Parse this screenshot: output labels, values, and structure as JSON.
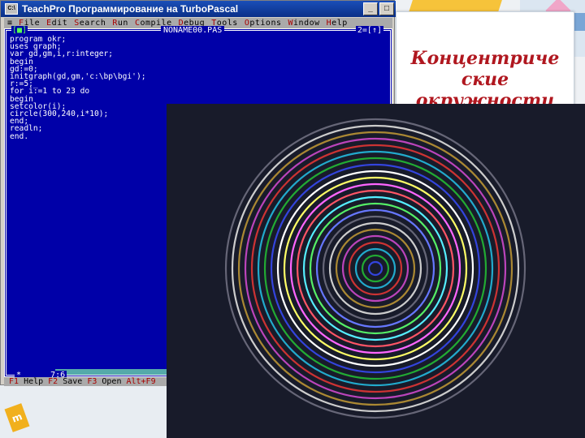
{
  "window": {
    "title": "TeachPro Программирование на TurboPascal",
    "app_icon_text": "C:\\"
  },
  "menu": [
    {
      "key": "F",
      "rest": "ile"
    },
    {
      "key": "E",
      "rest": "dit"
    },
    {
      "key": "S",
      "rest": "earch"
    },
    {
      "key": "R",
      "rest": "un"
    },
    {
      "key": "C",
      "rest": "ompile"
    },
    {
      "key": "D",
      "rest": "ebug"
    },
    {
      "key": "T",
      "rest": "ools"
    },
    {
      "key": "O",
      "rest": "ptions"
    },
    {
      "key": "W",
      "rest": "indow"
    },
    {
      "key": "H",
      "rest": "elp"
    }
  ],
  "editor": {
    "close_box": "[■]",
    "filename": "NONAME00.PAS",
    "window_number": "2=[↑]",
    "cursor_position": "7:6",
    "modified_marker": "*",
    "code": [
      "program okr;",
      "uses graph;",
      "var gd,gm,i,r:integer;",
      "begin",
      "gd:=0;",
      "initgraph(gd,gm,'c:\\bp\\bgi');",
      "r:=5;_",
      "for i:=1 to 23 do",
      "begin",
      "setcolor(i);",
      "circle(300,240,i*10);",
      "end;",
      "readln;",
      "end."
    ]
  },
  "statusbar": [
    {
      "key": "F1",
      "label": "Help"
    },
    {
      "key": "F2",
      "label": "Save"
    },
    {
      "key": "F3",
      "label": "Open"
    },
    {
      "key": "Alt+F9",
      "label": ""
    }
  ],
  "slide": {
    "title": "Концентриче\nские\nокружности"
  },
  "circles": {
    "count": 23,
    "colors": [
      "#3344dd",
      "#22aa33",
      "#22aacc",
      "#cc3333",
      "#bb44bb",
      "#aa8833",
      "#cccccc",
      "#666677",
      "#6677ff",
      "#55ee66",
      "#55eeff",
      "#ff5566",
      "#ff66ff",
      "#ffff66",
      "#ffffff",
      "#3344dd",
      "#22aa33",
      "#22aacc",
      "#cc3333",
      "#bb44bb",
      "#aa8833",
      "#cccccc",
      "#666677"
    ]
  }
}
